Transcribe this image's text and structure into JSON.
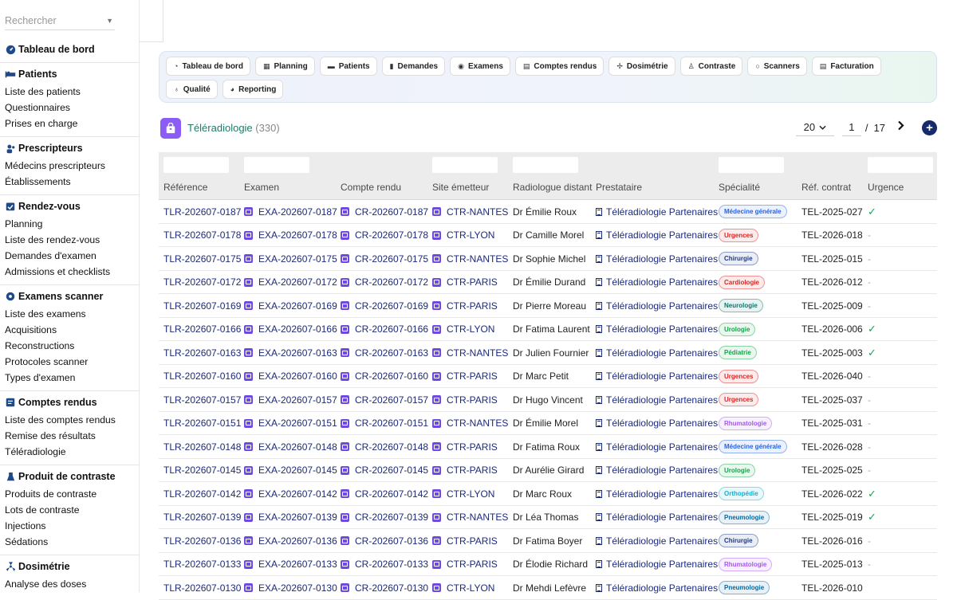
{
  "search": {
    "placeholder": "Rechercher"
  },
  "sidebar": {
    "dashboard": "Tableau de bord",
    "sections": [
      {
        "title": "Patients",
        "icon": "bed-icon",
        "items": [
          "Liste des patients",
          "Questionnaires",
          "Prises en charge"
        ]
      },
      {
        "title": "Prescripteurs",
        "icon": "users-icon",
        "items": [
          "Médecins prescripteurs",
          "Établissements"
        ]
      },
      {
        "title": "Rendez-vous",
        "icon": "calendar-check-icon",
        "items": [
          "Planning",
          "Liste des rendez-vous",
          "Demandes d'examen",
          "Admissions et checklists"
        ]
      },
      {
        "title": "Examens scanner",
        "icon": "disc-icon",
        "items": [
          "Liste des examens",
          "Acquisitions",
          "Reconstructions",
          "Protocoles scanner",
          "Types d'examen"
        ]
      },
      {
        "title": "Comptes rendus",
        "icon": "report-icon",
        "items": [
          "Liste des comptes rendus",
          "Remise des résultats",
          "Téléradiologie"
        ]
      },
      {
        "title": "Produit de contraste",
        "icon": "flask-icon",
        "items": [
          "Produits de contraste",
          "Lots de contraste",
          "Injections",
          "Sédations"
        ]
      },
      {
        "title": "Dosimétrie",
        "icon": "radiation-icon",
        "items": [
          "Analyse des doses"
        ]
      }
    ]
  },
  "nav": [
    {
      "label": "Tableau de bord",
      "icon": "gauge-icon"
    },
    {
      "label": "Planning",
      "icon": "calendar-icon"
    },
    {
      "label": "Patients",
      "icon": "bed-icon"
    },
    {
      "label": "Demandes",
      "icon": "file-icon"
    },
    {
      "label": "Examens",
      "icon": "disc-icon"
    },
    {
      "label": "Comptes rendus",
      "icon": "file-text-icon"
    },
    {
      "label": "Dosimétrie",
      "icon": "radiation-icon"
    },
    {
      "label": "Contraste",
      "icon": "flask-icon"
    },
    {
      "label": "Scanners",
      "icon": "circle-icon"
    },
    {
      "label": "Facturation",
      "icon": "invoice-icon"
    },
    {
      "label": "Qualité",
      "icon": "award-icon"
    },
    {
      "label": "Reporting",
      "icon": "chart-pie-icon"
    }
  ],
  "page": {
    "title": "Téléradiologie",
    "count": "(330)",
    "icon": "bag-icon"
  },
  "pager": {
    "page_size": "20",
    "current_page": "1",
    "separator": "/",
    "total_pages": "17"
  },
  "columns": [
    "Référence",
    "Examen",
    "Compte rendu",
    "Site émetteur",
    "Radiologue distant",
    "Prestataire",
    "Spécialité",
    "Réf. contrat",
    "Urgence"
  ],
  "specialty_colors": {
    "Médecine générale": "#2563eb",
    "Urgences": "#dc2626",
    "Chirurgie": "#1e3a8a",
    "Cardiologie": "#dc2626",
    "Neurologie": "#0f766e",
    "Urologie": "#16a34a",
    "Pédiatrie": "#16a34a",
    "Rhumatologie": "#a855f7",
    "Orthopédie": "#06b6d4",
    "Pneumologie": "#0369a1"
  },
  "rows": [
    {
      "ref": "TLR-202607-0187",
      "exam": "EXA-202607-0187",
      "report": "CR-202607-0187",
      "site": "CTR-NANTES",
      "radiologist": "Dr Émilie Roux",
      "provider": "Téléradiologie Partenaires",
      "specialty": "Médecine générale",
      "contract": "TEL-2025-027",
      "urgent": "✓"
    },
    {
      "ref": "TLR-202607-0178",
      "exam": "EXA-202607-0178",
      "report": "CR-202607-0178",
      "site": "CTR-LYON",
      "radiologist": "Dr Camille Morel",
      "provider": "Téléradiologie Partenaires",
      "specialty": "Urgences",
      "contract": "TEL-2026-018",
      "urgent": "-"
    },
    {
      "ref": "TLR-202607-0175",
      "exam": "EXA-202607-0175",
      "report": "CR-202607-0175",
      "site": "CTR-NANTES",
      "radiologist": "Dr Sophie Michel",
      "provider": "Téléradiologie Partenaires",
      "specialty": "Chirurgie",
      "contract": "TEL-2025-015",
      "urgent": "-"
    },
    {
      "ref": "TLR-202607-0172",
      "exam": "EXA-202607-0172",
      "report": "CR-202607-0172",
      "site": "CTR-PARIS",
      "radiologist": "Dr Émilie Durand",
      "provider": "Téléradiologie Partenaires",
      "specialty": "Cardiologie",
      "contract": "TEL-2026-012",
      "urgent": "-"
    },
    {
      "ref": "TLR-202607-0169",
      "exam": "EXA-202607-0169",
      "report": "CR-202607-0169",
      "site": "CTR-PARIS",
      "radiologist": "Dr Pierre Moreau",
      "provider": "Téléradiologie Partenaires",
      "specialty": "Neurologie",
      "contract": "TEL-2025-009",
      "urgent": "-"
    },
    {
      "ref": "TLR-202607-0166",
      "exam": "EXA-202607-0166",
      "report": "CR-202607-0166",
      "site": "CTR-LYON",
      "radiologist": "Dr Fatima Laurent",
      "provider": "Téléradiologie Partenaires",
      "specialty": "Urologie",
      "contract": "TEL-2026-006",
      "urgent": "✓"
    },
    {
      "ref": "TLR-202607-0163",
      "exam": "EXA-202607-0163",
      "report": "CR-202607-0163",
      "site": "CTR-NANTES",
      "radiologist": "Dr Julien Fournier",
      "provider": "Téléradiologie Partenaires",
      "specialty": "Pédiatrie",
      "contract": "TEL-2025-003",
      "urgent": "✓"
    },
    {
      "ref": "TLR-202607-0160",
      "exam": "EXA-202607-0160",
      "report": "CR-202607-0160",
      "site": "CTR-PARIS",
      "radiologist": "Dr Marc Petit",
      "provider": "Téléradiologie Partenaires",
      "specialty": "Urgences",
      "contract": "TEL-2026-040",
      "urgent": "-"
    },
    {
      "ref": "TLR-202607-0157",
      "exam": "EXA-202607-0157",
      "report": "CR-202607-0157",
      "site": "CTR-PARIS",
      "radiologist": "Dr Hugo Vincent",
      "provider": "Téléradiologie Partenaires",
      "specialty": "Urgences",
      "contract": "TEL-2025-037",
      "urgent": "-"
    },
    {
      "ref": "TLR-202607-0151",
      "exam": "EXA-202607-0151",
      "report": "CR-202607-0151",
      "site": "CTR-NANTES",
      "radiologist": "Dr Émilie Morel",
      "provider": "Téléradiologie Partenaires",
      "specialty": "Rhumatologie",
      "contract": "TEL-2025-031",
      "urgent": "-"
    },
    {
      "ref": "TLR-202607-0148",
      "exam": "EXA-202607-0148",
      "report": "CR-202607-0148",
      "site": "CTR-PARIS",
      "radiologist": "Dr Fatima Roux",
      "provider": "Téléradiologie Partenaires",
      "specialty": "Médecine générale",
      "contract": "TEL-2026-028",
      "urgent": "-"
    },
    {
      "ref": "TLR-202607-0145",
      "exam": "EXA-202607-0145",
      "report": "CR-202607-0145",
      "site": "CTR-PARIS",
      "radiologist": "Dr Aurélie Girard",
      "provider": "Téléradiologie Partenaires",
      "specialty": "Urologie",
      "contract": "TEL-2025-025",
      "urgent": "-"
    },
    {
      "ref": "TLR-202607-0142",
      "exam": "EXA-202607-0142",
      "report": "CR-202607-0142",
      "site": "CTR-LYON",
      "radiologist": "Dr Marc Roux",
      "provider": "Téléradiologie Partenaires",
      "specialty": "Orthopédie",
      "contract": "TEL-2026-022",
      "urgent": "✓"
    },
    {
      "ref": "TLR-202607-0139",
      "exam": "EXA-202607-0139",
      "report": "CR-202607-0139",
      "site": "CTR-NANTES",
      "radiologist": "Dr Léa Thomas",
      "provider": "Téléradiologie Partenaires",
      "specialty": "Pneumologie",
      "contract": "TEL-2025-019",
      "urgent": "✓"
    },
    {
      "ref": "TLR-202607-0136",
      "exam": "EXA-202607-0136",
      "report": "CR-202607-0136",
      "site": "CTR-PARIS",
      "radiologist": "Dr Fatima Boyer",
      "provider": "Téléradiologie Partenaires",
      "specialty": "Chirurgie",
      "contract": "TEL-2026-016",
      "urgent": "-"
    },
    {
      "ref": "TLR-202607-0133",
      "exam": "EXA-202607-0133",
      "report": "CR-202607-0133",
      "site": "CTR-PARIS",
      "radiologist": "Dr Élodie Richard",
      "provider": "Téléradiologie Partenaires",
      "specialty": "Rhumatologie",
      "contract": "TEL-2025-013",
      "urgent": "-"
    },
    {
      "ref": "TLR-202607-0130",
      "exam": "EXA-202607-0130",
      "report": "CR-202607-0130",
      "site": "CTR-LYON",
      "radiologist": "Dr Mehdi Lefèvre",
      "provider": "Téléradiologie Partenaires",
      "specialty": "Pneumologie",
      "contract": "TEL-2026-010",
      "urgent": ""
    }
  ]
}
